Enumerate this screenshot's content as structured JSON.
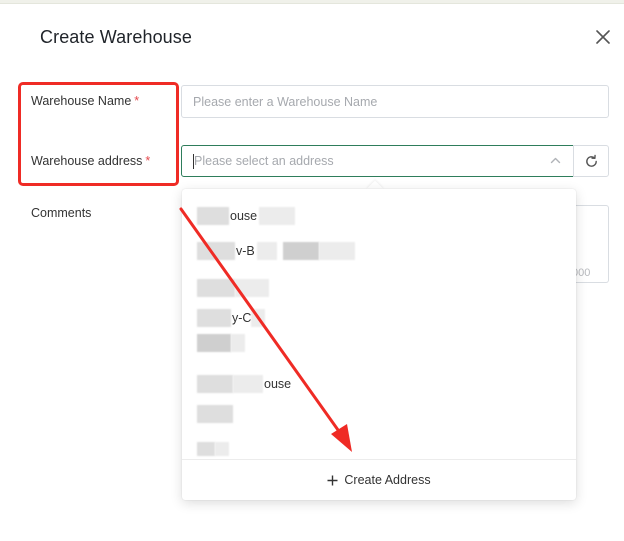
{
  "modal": {
    "title": "Create Warehouse",
    "close_icon": "close-icon"
  },
  "form": {
    "name": {
      "label": "Warehouse Name",
      "required_mark": "*",
      "placeholder": "Please enter a Warehouse Name"
    },
    "address": {
      "label": "Warehouse address",
      "required_mark": "*",
      "placeholder": "Please select an address",
      "chevron_icon": "chevron-up-icon",
      "refresh_icon": "refresh-icon"
    },
    "comments": {
      "label": "Comments",
      "count_fragment": "000"
    }
  },
  "dropdown": {
    "items": [
      {
        "visible_text": "ouse"
      },
      {
        "visible_text": "v-B"
      },
      {
        "visible_text": ""
      },
      {
        "visible_text": "y-C"
      },
      {
        "visible_text": ""
      },
      {
        "visible_text": "ouse"
      },
      {
        "visible_text": ""
      },
      {
        "visible_text": ""
      }
    ],
    "footer": {
      "label": "Create Address",
      "plus_icon": "plus-icon"
    }
  },
  "annotations": {
    "highlight_color": "#ef2b25"
  }
}
